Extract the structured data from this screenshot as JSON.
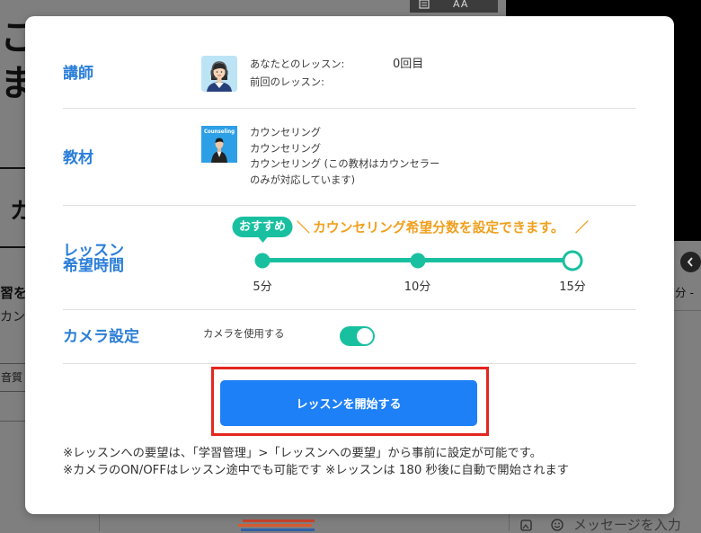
{
  "background": {
    "left": {
      "heading_1": "こ",
      "heading_2": "ま",
      "section": "カ",
      "item_title": "習を",
      "item_sub": "カン",
      "quality_box": "音質"
    },
    "toolbar": {
      "doc_icon": "book-icon",
      "font_size_label": "AA"
    },
    "right_text": "分 -",
    "chat": {
      "attach_icon": "image-upload-icon",
      "emoji_icon": "emoji-icon",
      "placeholder": "メッセージを入力"
    }
  },
  "modal": {
    "teacher": {
      "label": "講師",
      "avatar_icon": "teacher-avatar-icon",
      "lesson_count_label": "あなたとのレッスン:",
      "lesson_count_value": "0回目",
      "last_lesson_label": "前回のレッスン:"
    },
    "material": {
      "label": "教材",
      "cover_title": "Counseling",
      "lines": [
        "カウンセリング",
        "カウンセリング",
        "カウンセリング (この教材はカウンセラー",
        "のみが対応しています)"
      ]
    },
    "duration": {
      "label_lines": [
        "レッスン",
        "希望時間"
      ],
      "recommend_badge": "おすすめ",
      "recommended_index": 0,
      "hint_deco_left": "＼",
      "hint": "カウンセリング希望分数を設定できます。",
      "hint_deco_right": "／",
      "options": [
        "5分",
        "10分",
        "15分"
      ],
      "selected_index": 2
    },
    "camera": {
      "label": "カメラ設定",
      "toggle_label": "カメラを使用する",
      "enabled": true
    },
    "start_button": "レッスンを開始する",
    "notes": [
      "※レッスンへの要望は、「学習管理」>「レッスンへの要望」から事前に設定が可能です。",
      "※カメラのON/OFFはレッスン途中でも可能です ※レッスンは 180 秒後に自動で開始されます"
    ],
    "colors": {
      "label": "#2a7ed8",
      "accent": "#18c0a0",
      "hint": "#f0a01e",
      "button": "#1e80f6",
      "highlight": "#e3261f"
    }
  }
}
